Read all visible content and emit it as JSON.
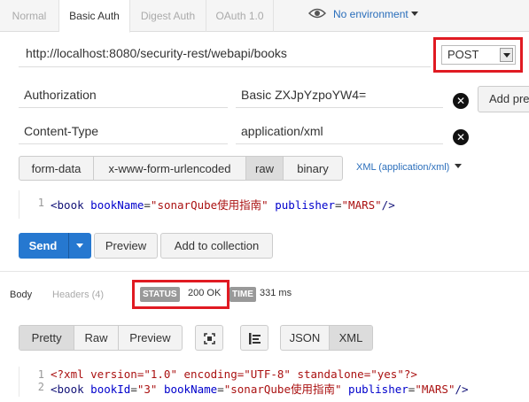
{
  "auth_tabs": [
    {
      "label": "Normal",
      "active": false
    },
    {
      "label": "Basic Auth",
      "active": true
    },
    {
      "label": "Digest Auth",
      "active": false
    },
    {
      "label": "OAuth 1.0",
      "active": false
    }
  ],
  "environment": {
    "label": "No environment",
    "icon": "eye-icon"
  },
  "request": {
    "url": "http://localhost:8080/security-rest/webapi/books",
    "method": "POST"
  },
  "headers": [
    {
      "key": "Authorization",
      "value": "Basic ZXJpYzpoYW4="
    },
    {
      "key": "Content-Type",
      "value": "application/xml"
    }
  ],
  "add_preset_label": "Add pre",
  "body_modes": [
    "form-data",
    "x-www-form-urlencoded",
    "raw",
    "binary"
  ],
  "body_mode_active": "raw",
  "raw_type": "XML (application/xml)",
  "request_body": {
    "line": "1",
    "open": "<",
    "tag": "book",
    "attr1": "bookName",
    "eq": "=",
    "val1": "\"sonarQube使用指南\"",
    "attr2": "publisher",
    "val2": "\"MARS\"",
    "close": "/>"
  },
  "actions": {
    "send": "Send",
    "preview": "Preview",
    "add_to_collection": "Add to collection"
  },
  "response_tabs": [
    {
      "label": "Body",
      "active": true
    },
    {
      "label": "Headers (4)",
      "active": false
    }
  ],
  "status": {
    "label": "STATUS",
    "value": "200 OK"
  },
  "time": {
    "label": "TIME",
    "value": "331 ms"
  },
  "view_modes": [
    "Pretty",
    "Raw",
    "Preview"
  ],
  "view_mode_active": "Pretty",
  "format_modes": [
    "JSON",
    "XML"
  ],
  "format_active": "XML",
  "response_body": [
    {
      "line": "1",
      "text": "<?xml version=\"1.0\" encoding=\"UTF-8\" standalone=\"yes\"?>"
    },
    {
      "line": "2",
      "open": "<",
      "tag": "book",
      "attr1": "bookId",
      "val1": "\"3\"",
      "attr2": "bookName",
      "val2": "\"sonarQube使用指南\"",
      "attr3": "publisher",
      "val3": "\"MARS\"",
      "close": "/>"
    }
  ],
  "colors": {
    "accent": "#2678d0",
    "highlight": "#e01a22",
    "link": "#2a6ebb"
  }
}
